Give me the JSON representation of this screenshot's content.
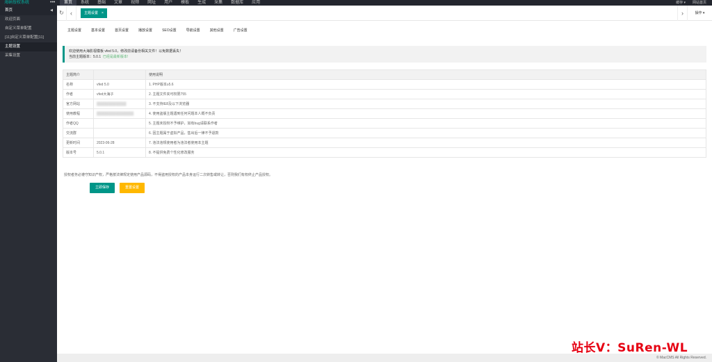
{
  "topbar": {
    "brand": "海纳授权系统",
    "more": "•••",
    "nav": [
      "首页",
      "系统",
      "基础",
      "文章",
      "视频",
      "网址",
      "用户",
      "模板",
      "生成",
      "采集",
      "数据库",
      "应用"
    ],
    "right": [
      "缓存 ▾",
      "网站首页"
    ]
  },
  "sidebar": {
    "header": "首页",
    "caret": "◀",
    "items": [
      "欢迎页面",
      "自定义菜单配置",
      "[11]自定义菜单配置[11]",
      "主题设置",
      "采集设置"
    ]
  },
  "tabbar": {
    "refresh": "↻",
    "prev": "‹",
    "active_tab": "主题设置",
    "close": "×",
    "next": "›",
    "ops": "操作 ▾"
  },
  "subtabs": [
    "主题设置",
    "基本设置",
    "首页设置",
    "播放设置",
    "SEO设置",
    "导航设置",
    "其他设置",
    "广告设置"
  ],
  "notice": {
    "line1": "欢迎使用大海影视模板 vfed 5.0，修改前请备份相关文件！以免数据丢失！",
    "line2_prefix": "当前主题版本：5.0.1",
    "line2_status": "已经是最新版本!"
  },
  "table": {
    "headers": [
      "主题简介",
      "",
      "使用说明"
    ],
    "rows": [
      [
        "名称",
        "vfed 5.0",
        "1. PHP版本≥5.6"
      ],
      [
        "作者",
        "vfed大海子",
        "2. 主题文件夹可权限755"
      ],
      [
        "官方网站",
        "████████████",
        "3. 不支持IE8及以下浏览器"
      ],
      [
        "使用教程",
        "███████████████",
        "4. 使用盗版主题遇到任何问题本人概不负责"
      ],
      [
        "作者QQ",
        "",
        "5. 主题未授权不予维护，如有bug请联系作者"
      ],
      [
        "交流群",
        "",
        "6. 因主题属于虚拟产品，售出后一律不予退款"
      ],
      [
        "更新时间",
        "2023-06-28",
        "7. 违法违规使用者为违法者使用本主题"
      ],
      [
        "版本号",
        "5.0.1",
        "8. 不提供免费个性化修改服务"
      ]
    ]
  },
  "foot_note": "授权者务必遵守知识产权，严格按法律规定使用产品源码，不得盗用授权的产品本身运行二次转售或转让，否则我们有权终止产品授权。",
  "buttons": {
    "save": "立即保存",
    "reset": "重置设置"
  },
  "watermark": "站长V：SuRen-WL",
  "footer": "© MacCMS All Rights Reserved.",
  "colors": {
    "accent": "#009688",
    "warning": "#ffb800",
    "topbar": "#23262e",
    "sidebar": "#2a2d35",
    "watermark": "#e60012"
  }
}
